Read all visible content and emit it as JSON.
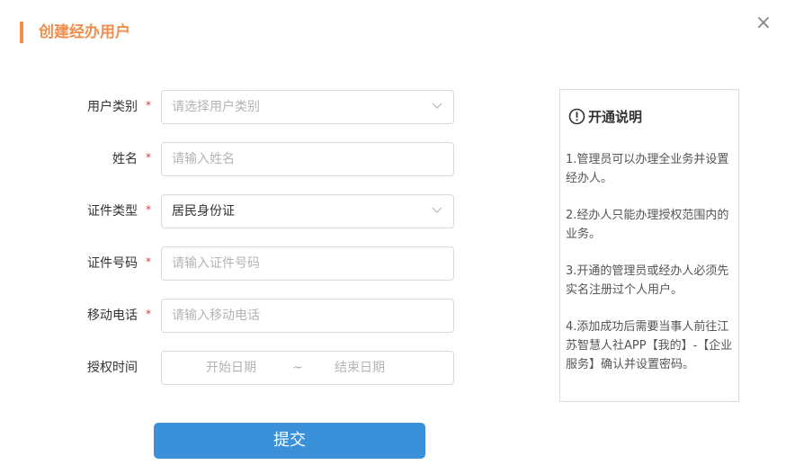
{
  "dialog": {
    "title": "创建经办用户",
    "close_label": "×"
  },
  "form": {
    "required_mark": "*",
    "user_type": {
      "label": "用户类别",
      "placeholder": "请选择用户类别"
    },
    "name": {
      "label": "姓名",
      "placeholder": "请输入姓名"
    },
    "id_type": {
      "label": "证件类型",
      "value": "居民身份证"
    },
    "id_number": {
      "label": "证件号码",
      "placeholder": "请输入证件号码"
    },
    "mobile": {
      "label": "移动电话",
      "placeholder": "请输入移动电话"
    },
    "auth_time": {
      "label": "授权时间",
      "start_placeholder": "开始日期",
      "separator": "~",
      "end_placeholder": "结束日期"
    },
    "submit_label": "提交"
  },
  "info": {
    "title": "开通说明",
    "icon": "exclamation-circle-icon",
    "items": [
      "1.管理员可以办理全业务并设置经办人。",
      "2.经办人只能办理授权范围内的业务。",
      "3.开通的管理员或经办人必须先实名注册过个人用户。",
      "4.添加成功后需要当事人前往江苏智慧人社APP【我的】-【企业服务】确认并设置密码。"
    ]
  },
  "colors": {
    "accent": "#f08e4c",
    "primary": "#3a90d9",
    "required": "#e23b3b"
  }
}
